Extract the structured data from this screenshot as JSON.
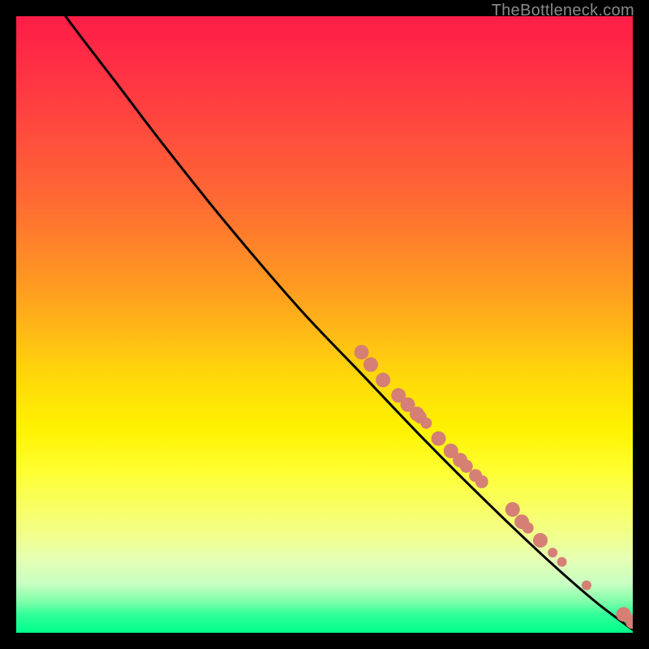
{
  "attribution": "TheBottleneck.com",
  "chart_data": {
    "type": "line",
    "title": "",
    "xlabel": "",
    "ylabel": "",
    "xlim": [
      0,
      100
    ],
    "ylim": [
      0,
      100
    ],
    "curve": [
      {
        "x": 8.0,
        "y": 100.0
      },
      {
        "x": 11.0,
        "y": 96.0
      },
      {
        "x": 16.0,
        "y": 89.5
      },
      {
        "x": 24.0,
        "y": 79.0
      },
      {
        "x": 34.0,
        "y": 66.5
      },
      {
        "x": 46.0,
        "y": 52.5
      },
      {
        "x": 56.0,
        "y": 42.0
      },
      {
        "x": 66.0,
        "y": 31.5
      },
      {
        "x": 76.0,
        "y": 21.5
      },
      {
        "x": 86.0,
        "y": 12.0
      },
      {
        "x": 94.0,
        "y": 5.0
      },
      {
        "x": 100.0,
        "y": 0.5
      }
    ],
    "markers": [
      {
        "x": 56.0,
        "y": 45.5,
        "r": 9
      },
      {
        "x": 57.5,
        "y": 43.5,
        "r": 9
      },
      {
        "x": 59.5,
        "y": 41.0,
        "r": 9
      },
      {
        "x": 62.0,
        "y": 38.5,
        "r": 9
      },
      {
        "x": 63.5,
        "y": 37.0,
        "r": 9
      },
      {
        "x": 65.0,
        "y": 35.5,
        "r": 9
      },
      {
        "x": 65.5,
        "y": 35.0,
        "r": 8
      },
      {
        "x": 66.5,
        "y": 34.0,
        "r": 7
      },
      {
        "x": 68.5,
        "y": 31.5,
        "r": 9
      },
      {
        "x": 70.5,
        "y": 29.5,
        "r": 9
      },
      {
        "x": 72.0,
        "y": 28.0,
        "r": 9
      },
      {
        "x": 73.0,
        "y": 27.0,
        "r": 8
      },
      {
        "x": 74.5,
        "y": 25.5,
        "r": 8
      },
      {
        "x": 75.5,
        "y": 24.5,
        "r": 8
      },
      {
        "x": 80.5,
        "y": 20.0,
        "r": 9
      },
      {
        "x": 82.0,
        "y": 18.0,
        "r": 9
      },
      {
        "x": 83.0,
        "y": 17.0,
        "r": 7
      },
      {
        "x": 85.0,
        "y": 15.0,
        "r": 9
      },
      {
        "x": 87.0,
        "y": 13.0,
        "r": 6
      },
      {
        "x": 88.5,
        "y": 11.5,
        "r": 6
      },
      {
        "x": 92.5,
        "y": 7.7,
        "r": 6
      },
      {
        "x": 98.5,
        "y": 3.0,
        "r": 9
      },
      {
        "x": 100.0,
        "y": 1.8,
        "r": 9
      }
    ],
    "marker_color": "#d57f75",
    "curve_color": "#000000"
  }
}
